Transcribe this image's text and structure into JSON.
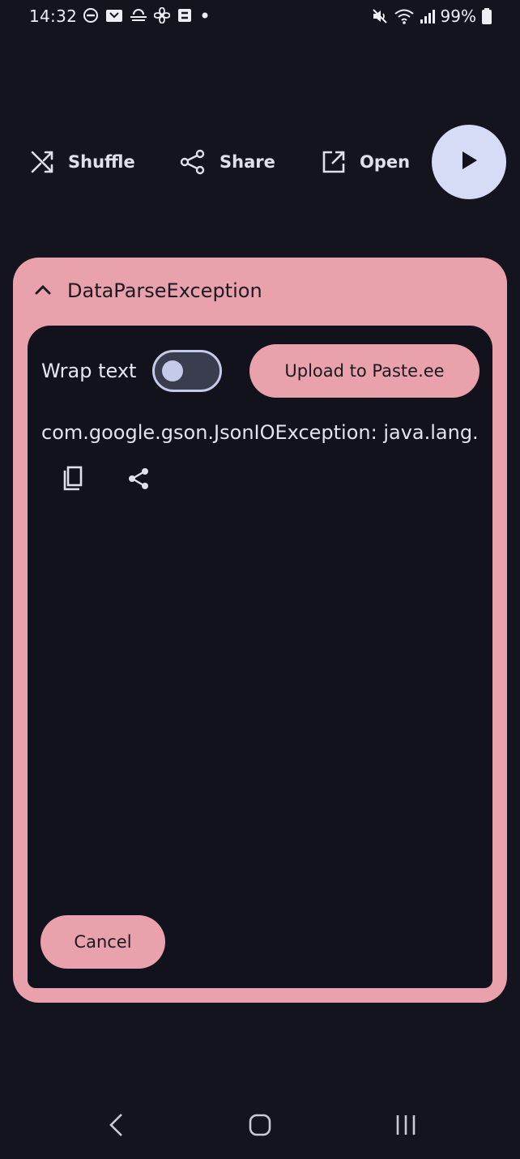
{
  "status_bar": {
    "time": "14:32",
    "battery": "99%",
    "left_icons": [
      "dnd-icon",
      "notification-icon",
      "weather-icon",
      "fan-icon",
      "app-icon",
      "dot-icon"
    ],
    "right_icons": [
      "mute-icon",
      "wifi-icon",
      "signal-icon",
      "battery-icon"
    ]
  },
  "actions": {
    "shuffle_label": "Shuffle",
    "share_label": "Share",
    "open_label": "Open",
    "play_icon": "play-icon"
  },
  "error_card": {
    "title": "DataParseException",
    "wrap_label": "Wrap text",
    "wrap_enabled": false,
    "upload_label": "Upload to Paste.ee",
    "exception_text": "com.google.gson.JsonIOException: java.lang.IllegalStateException",
    "cancel_label": "Cancel"
  },
  "colors": {
    "background": "#13141e",
    "card": "#e9a1ab",
    "panel": "#11121c",
    "play_button": "#d6dcf5",
    "toggle_accent": "#c5cae8"
  }
}
